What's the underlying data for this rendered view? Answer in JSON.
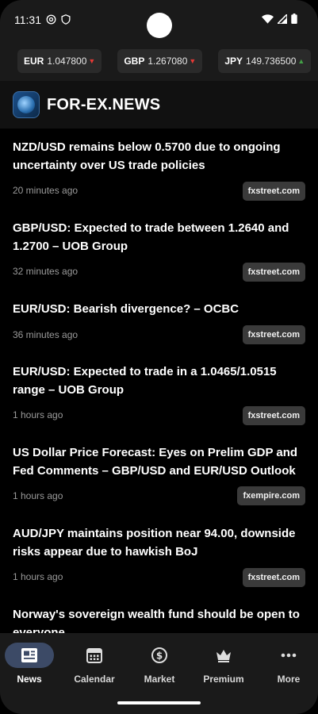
{
  "status": {
    "time": "11:31"
  },
  "ticker": [
    {
      "symbol": "EUR",
      "value": "1.047800",
      "direction": "down"
    },
    {
      "symbol": "GBP",
      "value": "1.267080",
      "direction": "down"
    },
    {
      "symbol": "JPY",
      "value": "149.736500",
      "direction": "up"
    }
  ],
  "app": {
    "title": "FOR-EX.NEWS",
    "logo_icon": "globe-logo-icon"
  },
  "news": [
    {
      "title": "NZD/USD remains below 0.5700 due to ongoing uncertainty over US trade policies",
      "time": "20 minutes ago",
      "source": "fxstreet.com"
    },
    {
      "title": "GBP/USD: Expected to trade between 1.2640 and 1.2700 – UOB Group",
      "time": "32 minutes ago",
      "source": "fxstreet.com"
    },
    {
      "title": "EUR/USD: Bearish divergence? – OCBC",
      "time": "36 minutes ago",
      "source": "fxstreet.com"
    },
    {
      "title": "EUR/USD: Expected to trade in a 1.0465/1.0515 range – UOB Group",
      "time": "1 hours ago",
      "source": "fxstreet.com"
    },
    {
      "title": "US Dollar Price Forecast: Eyes on Prelim GDP and Fed Comments – GBP/USD and EUR/USD Outlook",
      "time": "1 hours ago",
      "source": "fxempire.com"
    },
    {
      "title": "AUD/JPY maintains position near 94.00, downside risks appear due to hawkish BoJ",
      "time": "1 hours ago",
      "source": "fxstreet.com"
    },
    {
      "title": "Norway's sovereign wealth fund should be open to everyone",
      "time": "",
      "source": ""
    }
  ],
  "nav": [
    {
      "label": "News",
      "icon": "newspaper-icon",
      "active": true
    },
    {
      "label": "Calendar",
      "icon": "calendar-icon",
      "active": false
    },
    {
      "label": "Market",
      "icon": "coin-icon",
      "active": false
    },
    {
      "label": "Premium",
      "icon": "crown-icon",
      "active": false
    },
    {
      "label": "More",
      "icon": "more-icon",
      "active": false
    }
  ],
  "colors": {
    "background": "#000000",
    "bar_background": "#1a1a1a",
    "down": "#e53935",
    "up": "#43a047",
    "active_nav": "#3c4a66"
  }
}
